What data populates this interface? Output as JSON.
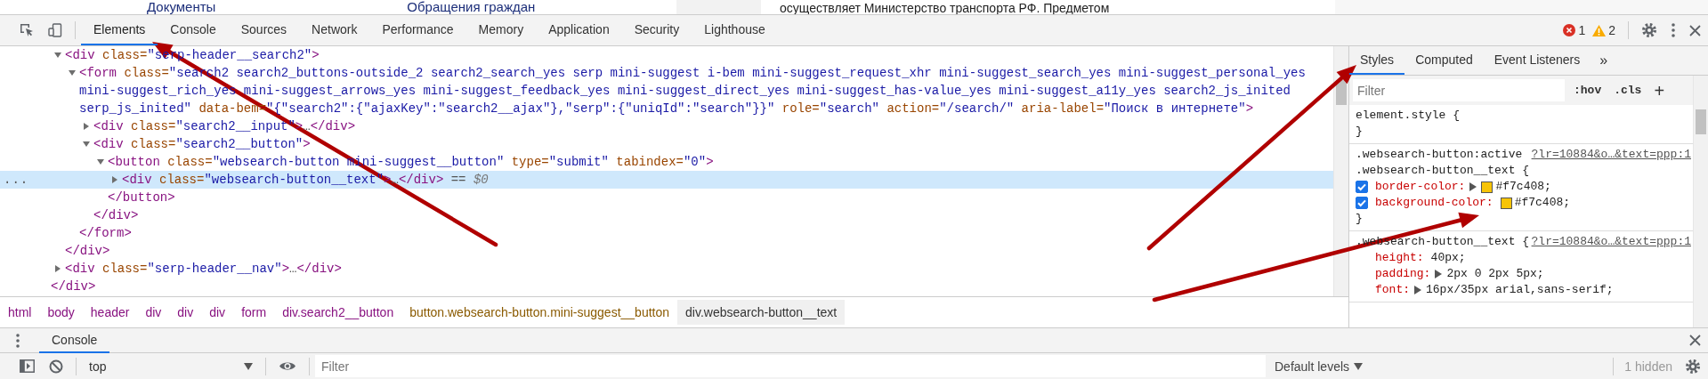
{
  "page_behind": {
    "links": [
      "Документы",
      "Обращения граждан"
    ],
    "snippet": "осуществляет Министерство транспорта РФ. Предметом"
  },
  "toolbar": {
    "tabs": [
      {
        "label": "Elements",
        "selected": true
      },
      {
        "label": "Console",
        "selected": false
      },
      {
        "label": "Sources",
        "selected": false
      },
      {
        "label": "Network",
        "selected": false
      },
      {
        "label": "Performance",
        "selected": false
      },
      {
        "label": "Memory",
        "selected": false
      },
      {
        "label": "Application",
        "selected": false
      },
      {
        "label": "Security",
        "selected": false
      },
      {
        "label": "Lighthouse",
        "selected": false
      }
    ],
    "error_count": "1",
    "warning_count": "2"
  },
  "elements_panel": {
    "nodes": [
      {
        "kind": "element",
        "expanded": true,
        "selected": false,
        "tokens": [
          {
            "kind": "tag",
            "text": "<div"
          },
          {
            "kind": "attr",
            "text": " class="
          },
          {
            "kind": "value",
            "text": "\"serp-header__search2\""
          },
          {
            "kind": "tag",
            "text": ">"
          }
        ],
        "children": [
          {
            "kind": "element",
            "expanded": true,
            "selected": false,
            "tokens": [
              {
                "kind": "tag",
                "text": "<form"
              },
              {
                "kind": "attr",
                "text": " class="
              },
              {
                "kind": "value",
                "text": "\"search2 search2_buttons-outside_2 search2_search_yes serp mini-suggest i-bem mini-suggest_request_xhr mini-suggest_search_yes mini-suggest_personal_yes mini-suggest_rich_yes mini-suggest_arrows_yes mini-suggest_feedback_yes mini-suggest_direct_yes mini-suggest_has-value_yes mini-suggest_a11y_yes search2_js_inited serp_js_inited\""
              },
              {
                "kind": "attr",
                "text": " data-bem="
              },
              {
                "kind": "value",
                "text": "\"{\"search2\":{\"ajaxKey\":\"search2__ajax\"},\"serp\":{\"uniqId\":\"search\"}}\""
              },
              {
                "kind": "attr",
                "text": " role="
              },
              {
                "kind": "value",
                "text": "\"search\""
              },
              {
                "kind": "attr",
                "text": " action="
              },
              {
                "kind": "value",
                "text": "\"/search/\""
              },
              {
                "kind": "attr",
                "text": " aria-label="
              },
              {
                "kind": "value",
                "text": "\"Поиск в интернете\""
              },
              {
                "kind": "tag",
                "text": ">"
              }
            ],
            "children": [
              {
                "kind": "element",
                "expanded": false,
                "selected": false,
                "tokens": [
                  {
                    "kind": "tag",
                    "text": "<div"
                  },
                  {
                    "kind": "attr",
                    "text": " class="
                  },
                  {
                    "kind": "value",
                    "text": "\"search2__input\""
                  },
                  {
                    "kind": "tag",
                    "text": ">"
                  },
                  {
                    "kind": "dim",
                    "text": "…"
                  },
                  {
                    "kind": "tag",
                    "text": "</div>"
                  }
                ]
              },
              {
                "kind": "element",
                "expanded": true,
                "selected": false,
                "tokens": [
                  {
                    "kind": "tag",
                    "text": "<div"
                  },
                  {
                    "kind": "attr",
                    "text": " class="
                  },
                  {
                    "kind": "value",
                    "text": "\"search2__button\""
                  },
                  {
                    "kind": "tag",
                    "text": ">"
                  }
                ],
                "children": [
                  {
                    "kind": "element",
                    "expanded": true,
                    "selected": false,
                    "tokens": [
                      {
                        "kind": "tag",
                        "text": "<button"
                      },
                      {
                        "kind": "attr",
                        "text": " class="
                      },
                      {
                        "kind": "value",
                        "text": "\"websearch-button mini-suggest__button\""
                      },
                      {
                        "kind": "attr",
                        "text": " type="
                      },
                      {
                        "kind": "value",
                        "text": "\"submit\""
                      },
                      {
                        "kind": "attr",
                        "text": " tabindex="
                      },
                      {
                        "kind": "value",
                        "text": "\"0\""
                      },
                      {
                        "kind": "tag",
                        "text": ">"
                      }
                    ],
                    "children": [
                      {
                        "kind": "element",
                        "expanded": false,
                        "selected": true,
                        "menu": "...",
                        "tokens": [
                          {
                            "kind": "tag",
                            "text": "<div"
                          },
                          {
                            "kind": "attr",
                            "text": " class="
                          },
                          {
                            "kind": "value",
                            "text": "\"websearch-button__text\""
                          },
                          {
                            "kind": "tag",
                            "text": ">"
                          },
                          {
                            "kind": "dim",
                            "text": "…"
                          },
                          {
                            "kind": "tag",
                            "text": "</div>"
                          },
                          {
                            "kind": "dim",
                            "text": " == "
                          },
                          {
                            "kind": "ref",
                            "text": "$0"
                          }
                        ]
                      },
                      {
                        "kind": "close",
                        "selected": false,
                        "tokens": [
                          {
                            "kind": "tag",
                            "text": "</button>"
                          }
                        ]
                      }
                    ]
                  },
                  {
                    "kind": "close",
                    "selected": false,
                    "tokens": [
                      {
                        "kind": "tag",
                        "text": "</div>"
                      }
                    ]
                  }
                ]
              },
              {
                "kind": "close",
                "selected": false,
                "tokens": [
                  {
                    "kind": "tag",
                    "text": "</form>"
                  }
                ]
              }
            ]
          },
          {
            "kind": "close",
            "selected": false,
            "tokens": [
              {
                "kind": "tag",
                "text": "</div>"
              }
            ]
          }
        ]
      },
      {
        "kind": "element",
        "expanded": false,
        "selected": false,
        "tokens": [
          {
            "kind": "tag",
            "text": "<div"
          },
          {
            "kind": "attr",
            "text": " class="
          },
          {
            "kind": "value",
            "text": "\"serp-header__nav\""
          },
          {
            "kind": "tag",
            "text": ">"
          },
          {
            "kind": "dim",
            "text": "…"
          },
          {
            "kind": "tag",
            "text": "</div>"
          }
        ]
      },
      {
        "kind": "close",
        "selected": false,
        "tokens": [
          {
            "kind": "tag",
            "text": "</div>"
          }
        ]
      }
    ]
  },
  "breadcrumbs": [
    {
      "label": "html",
      "selected": false,
      "hovered": false
    },
    {
      "label": "body",
      "selected": false,
      "hovered": false
    },
    {
      "label": "header",
      "selected": false,
      "hovered": false
    },
    {
      "label": "div",
      "selected": false,
      "hovered": false
    },
    {
      "label": "div",
      "selected": false,
      "hovered": false
    },
    {
      "label": "div",
      "selected": false,
      "hovered": false
    },
    {
      "label": "form",
      "selected": false,
      "hovered": false
    },
    {
      "label": "div.search2__button",
      "selected": false,
      "hovered": false
    },
    {
      "label": "button.websearch-button.mini-suggest__button",
      "selected": false,
      "hovered": true
    },
    {
      "label": "div.websearch-button__text",
      "selected": true,
      "hovered": false
    }
  ],
  "styles_pane": {
    "tabs": [
      {
        "label": "Styles",
        "selected": true
      },
      {
        "label": "Computed",
        "selected": false
      },
      {
        "label": "Event Listeners",
        "selected": false
      }
    ],
    "more": "»",
    "filter": {
      "placeholder": "Filter"
    },
    "hov": ":hov",
    "cls": ".cls",
    "add": "+",
    "rules": [
      {
        "selector": "element.style {",
        "close": "}"
      },
      {
        "source": "?lr=10884&o…&text=ppp:1",
        "selector": ".websearch-button:active .websearch-button__text {",
        "properties": [
          {
            "name": "border-color:",
            "expandable": true,
            "color": "#f7c408",
            "value": "#f7c408;",
            "checked": true
          },
          {
            "name": "background-color:",
            "expandable": false,
            "color": "#f7c408",
            "value": "#f7c408;",
            "checked": true
          }
        ],
        "close": "}"
      },
      {
        "source": "?lr=10884&o…&text=ppp:1",
        "selector": ".websearch-button__text {",
        "properties": [
          {
            "name": "height:",
            "expandable": false,
            "value": "40px;"
          },
          {
            "name": "padding:",
            "expandable": true,
            "value": "2px 0 2px 5px;"
          },
          {
            "name": "font:",
            "expandable": true,
            "value": "16px/35px arial,sans-serif;"
          }
        ]
      }
    ]
  },
  "drawer": {
    "tabs": [
      {
        "label": "Console",
        "selected": true
      }
    ],
    "context": "top",
    "filter": {
      "placeholder": "Filter"
    },
    "levels": "Default levels",
    "hidden": "1 hidden"
  }
}
